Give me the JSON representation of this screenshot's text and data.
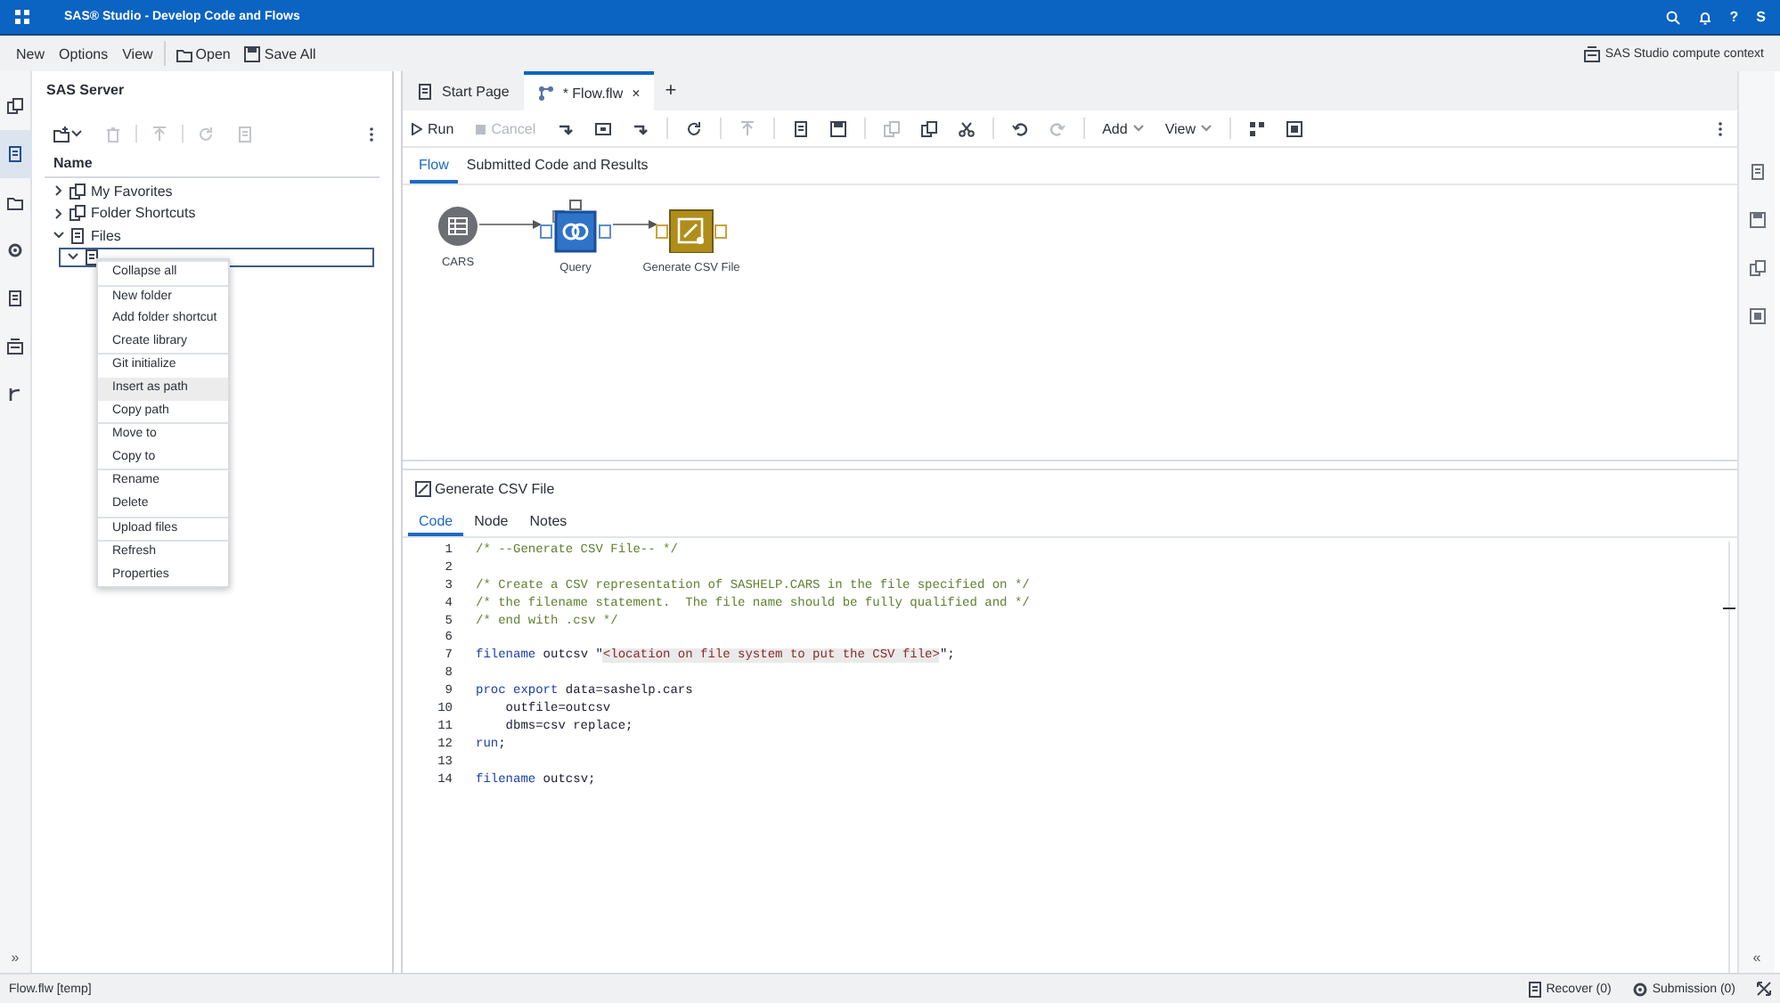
{
  "header": {
    "title": "SAS® Studio - Develop Code and Flows",
    "help": "?",
    "user_initial": "S"
  },
  "menubar": {
    "items": [
      {
        "label": "New",
        "kind": "text"
      },
      {
        "label": "Options",
        "kind": "text"
      },
      {
        "label": "View",
        "kind": "text"
      },
      {
        "kind": "separator"
      },
      {
        "label": "Open",
        "kind": "open"
      },
      {
        "label": "Save All",
        "kind": "save"
      }
    ],
    "context": "SAS Studio compute context"
  },
  "left_rail": {
    "items": [
      {
        "selected": false
      },
      {
        "selected": true
      },
      {
        "selected": false
      },
      {
        "selected": false
      },
      {
        "selected": false
      },
      {
        "selected": false
      },
      {
        "selected": false
      }
    ],
    "expand": "»"
  },
  "explorer": {
    "title": "SAS Server",
    "toolbar": [
      {
        "kind": "new",
        "disabled": false
      },
      {
        "kind": "delete",
        "disabled": true
      },
      {
        "kind": "separator"
      },
      {
        "kind": "upload",
        "disabled": true
      },
      {
        "kind": "separator"
      },
      {
        "kind": "refresh",
        "disabled": true
      },
      {
        "kind": "properties",
        "disabled": true
      },
      {
        "kind": "more",
        "disabled": false
      }
    ],
    "column": "Name",
    "tree": [
      {
        "label": "My Favorites",
        "expanded": false
      },
      {
        "label": "Folder Shortcuts",
        "expanded": false
      },
      {
        "label": "Files",
        "expanded": true,
        "children": [
          {
            "expanded": true,
            "selected": true
          }
        ]
      }
    ]
  },
  "context_menu": {
    "groups": [
      [
        {
          "label": "Collapse all",
          "selected": false
        }
      ],
      [
        {
          "label": "New folder",
          "selected": false
        },
        {
          "label": "Add folder shortcut",
          "selected": false
        },
        {
          "label": "Create library",
          "selected": false
        }
      ],
      [
        {
          "label": "Git initialize",
          "selected": false
        },
        {
          "label": "Insert as path",
          "selected": true
        },
        {
          "label": "Copy path",
          "selected": false
        }
      ],
      [
        {
          "label": "Move to",
          "selected": false
        },
        {
          "label": "Copy to",
          "selected": false
        }
      ],
      [
        {
          "label": "Rename",
          "selected": false
        },
        {
          "label": "Delete",
          "selected": false
        }
      ],
      [
        {
          "label": "Upload files",
          "selected": false
        }
      ],
      [
        {
          "label": "Refresh",
          "selected": false
        },
        {
          "label": "Properties",
          "selected": false
        }
      ]
    ]
  },
  "editor_tabs": {
    "tabs": [
      {
        "label": "Start Page",
        "kind": "page",
        "selected": false
      },
      {
        "label": "* Flow.flw",
        "kind": "flow",
        "selected": true,
        "close": "×"
      }
    ],
    "new_tab": "+"
  },
  "toolbar": [
    {
      "kind": "button",
      "label": "Run",
      "disabled": false
    },
    {
      "kind": "button",
      "label": "Cancel",
      "disabled": true
    },
    {
      "kind": "icon",
      "disabled": false
    },
    {
      "kind": "icon",
      "disabled": false
    },
    {
      "kind": "icon",
      "disabled": false
    },
    {
      "kind": "separator"
    },
    {
      "kind": "icon",
      "disabled": false
    },
    {
      "kind": "separator"
    },
    {
      "kind": "icon",
      "disabled": true
    },
    {
      "kind": "separator"
    },
    {
      "kind": "icon",
      "disabled": false
    },
    {
      "kind": "icon",
      "disabled": false
    },
    {
      "kind": "separator"
    },
    {
      "kind": "icon",
      "disabled": true
    },
    {
      "kind": "icon",
      "disabled": false
    },
    {
      "kind": "icon",
      "disabled": false
    },
    {
      "kind": "separator"
    },
    {
      "kind": "icon",
      "disabled": false
    },
    {
      "kind": "icon",
      "disabled": true
    },
    {
      "kind": "separator"
    },
    {
      "kind": "menu",
      "label": "Add",
      "disabled": false
    },
    {
      "kind": "menu",
      "label": "View",
      "disabled": false
    },
    {
      "kind": "separator"
    },
    {
      "kind": "icon",
      "disabled": false
    },
    {
      "kind": "icon",
      "disabled": false
    }
  ],
  "flow_tabs": [
    {
      "label": "Flow",
      "selected": true
    },
    {
      "label": "Submitted Code and Results",
      "selected": false
    }
  ],
  "nodes": [
    {
      "label": "CARS",
      "kind": "table",
      "selected": false
    },
    {
      "label": "Query",
      "kind": "query",
      "selected": true
    },
    {
      "label": "Generate CSV File",
      "kind": "export",
      "selected": false
    }
  ],
  "node_panel": {
    "title": "Generate CSV File",
    "tabs": [
      {
        "label": "Code",
        "selected": true
      },
      {
        "label": "Node",
        "selected": false
      },
      {
        "label": "Notes",
        "selected": false
      }
    ],
    "code": [
      {
        "number": "1",
        "tokens": [
          {
            "kind": "comment",
            "text": "/* --Generate CSV File-- */"
          }
        ]
      },
      {
        "number": "2"
      },
      {
        "number": "3",
        "tokens": [
          {
            "kind": "comment",
            "text": "/* Create a CSV representation of SASHELP.CARS in the file specified on */"
          }
        ]
      },
      {
        "number": "4",
        "tokens": [
          {
            "kind": "comment",
            "text": "/* the filename statement.  The file name should be fully qualified and */"
          }
        ]
      },
      {
        "number": "5",
        "tokens": [
          {
            "kind": "comment",
            "text": "/* end with .csv */"
          }
        ]
      },
      {
        "number": "6"
      },
      {
        "number": "7",
        "tokens": [
          {
            "kind": "keyword",
            "text": "filename"
          },
          {
            "kind": "plain",
            "text": " outcsv \""
          },
          {
            "kind": "string",
            "text": "<location on file system to put the CSV file>"
          },
          {
            "kind": "plain",
            "text": "\";"
          }
        ]
      },
      {
        "number": "8"
      },
      {
        "number": "9",
        "tokens": [
          {
            "kind": "keyword",
            "text": "proc export"
          },
          {
            "kind": "plain",
            "text": " data=sashelp.cars"
          }
        ]
      },
      {
        "number": "10",
        "tokens": [
          {
            "kind": "plain",
            "text": "    outfile=outcsv"
          }
        ]
      },
      {
        "number": "11",
        "tokens": [
          {
            "kind": "plain",
            "text": "    dbms=csv replace;"
          }
        ]
      },
      {
        "number": "12",
        "tokens": [
          {
            "kind": "keyword",
            "text": "run"
          },
          {
            "kind": "plain",
            "text": ";"
          }
        ]
      },
      {
        "number": "13"
      },
      {
        "number": "14",
        "tokens": [
          {
            "kind": "keyword",
            "text": "filename"
          },
          {
            "kind": "plain",
            "text": " outcsv;"
          }
        ]
      }
    ]
  },
  "right_rail": {
    "collapse": "«"
  },
  "status_bar": {
    "file": "Flow.flw [temp]",
    "items": [
      {
        "label": "Recover (0)",
        "kind": "recover"
      },
      {
        "label": "Submission (0)",
        "kind": "submission"
      }
    ]
  }
}
